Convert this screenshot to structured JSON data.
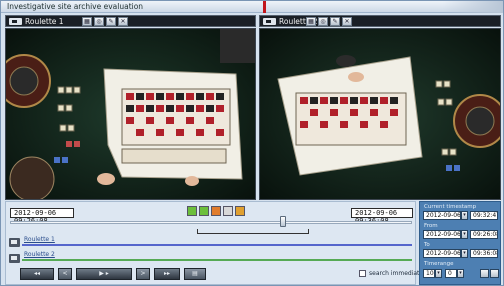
{
  "window": {
    "title": "Investigative site archive evaluation"
  },
  "cameras": [
    {
      "name": "Roulette 1"
    },
    {
      "name": "Roulette 2"
    }
  ],
  "timeline": {
    "start_time": "2012-09-06 09:26:08",
    "end_time": "2012-09-06 09:36:08",
    "slider_position": 0.68,
    "tracks": [
      {
        "label": "Roulette 1",
        "color": "#5566cc"
      },
      {
        "label": "Roulette 2",
        "color": "#55aa55"
      }
    ]
  },
  "playback": {
    "search_immediately_label": "search immediately"
  },
  "right_panel": {
    "current_label": "Current timestamp",
    "current_date": "2012-09-06",
    "current_time": "09:32:47",
    "from_label": "From",
    "from_date": "2012-09-06",
    "from_time": "09:26:08",
    "to_label": "To",
    "to_date": "2012-09-06",
    "to_time": "09:36:08",
    "interval_label": "Timerange",
    "interval_a": "10",
    "interval_b": "0"
  },
  "colors": {
    "accent_red": "#c2151b",
    "panel_blue": "#4d7fb2"
  }
}
